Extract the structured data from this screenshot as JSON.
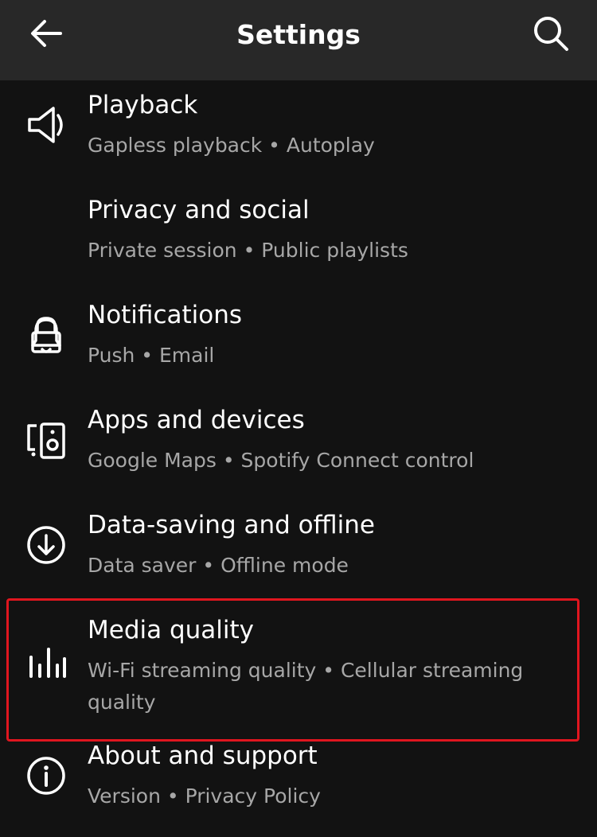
{
  "header": {
    "title": "Settings",
    "back_icon": "arrow-left-icon",
    "search_icon": "search-icon"
  },
  "settings": {
    "items": [
      {
        "label": "Playback",
        "subtitle": "Gapless playback • Autoplay",
        "icon": "speaker-icon"
      },
      {
        "label": "Privacy and social",
        "subtitle": "Private session • Public playlists",
        "icon": "lock-icon"
      },
      {
        "label": "Notifications",
        "subtitle": "Push • Email",
        "icon": "bell-icon"
      },
      {
        "label": "Apps and devices",
        "subtitle": "Google Maps • Spotify Connect control",
        "icon": "devices-icon"
      },
      {
        "label": "Data-saving and offline",
        "subtitle": "Data saver • Offline mode",
        "icon": "download-circle-icon"
      },
      {
        "label": "Media quality",
        "subtitle": "Wi-Fi streaming quality • Cellular streaming quality",
        "icon": "equalizer-icon"
      },
      {
        "label": "About and support",
        "subtitle": "Version • Privacy Policy",
        "icon": "info-icon"
      }
    ]
  },
  "colors": {
    "background": "#121212",
    "header_background": "#282828",
    "text_primary": "#ffffff",
    "text_secondary": "#a7a7a7",
    "highlight_border": "#e0161f"
  }
}
